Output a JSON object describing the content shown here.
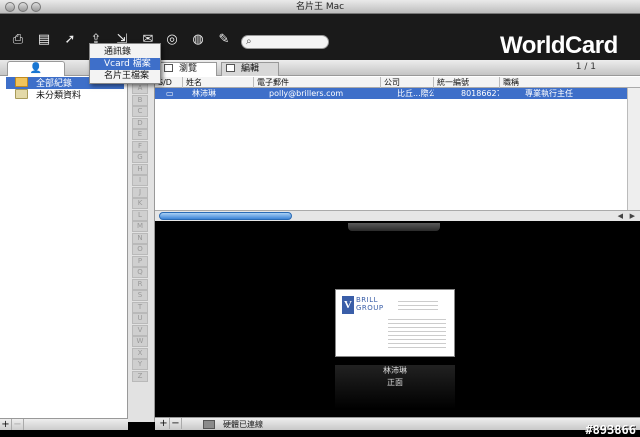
{
  "window": {
    "title": "名片王 Mac"
  },
  "toolbar": {
    "icons": [
      "scan-icon",
      "new-card-icon",
      "cursor-icon",
      "export-icon",
      "share-icon",
      "mail-icon",
      "sync-icon",
      "web-icon",
      "edit-icon"
    ],
    "brand": "WorldCard",
    "search_value": ""
  },
  "export_menu": {
    "items": [
      "通訊錄",
      "Vcard 檔案",
      "名片王檔案"
    ],
    "highlighted": "Vcard 檔案"
  },
  "sidebar": {
    "folders": [
      {
        "label": "全部紀錄",
        "selected": true
      },
      {
        "label": "未分類資料",
        "selected": false
      }
    ]
  },
  "alpha_index": [
    "A",
    "B",
    "C",
    "D",
    "E",
    "F",
    "G",
    "H",
    "I",
    "J",
    "K",
    "L",
    "M",
    "N",
    "O",
    "P",
    "Q",
    "R",
    "S",
    "T",
    "U",
    "V",
    "W",
    "X",
    "Y",
    "Z"
  ],
  "tabs": [
    {
      "label": "瀏覽",
      "active": true
    },
    {
      "label": "編輯",
      "active": false
    }
  ],
  "pager": "1 / 1",
  "table": {
    "columns": [
      "S/D",
      "姓名",
      "電子郵件",
      "公司",
      "統一編號",
      "職稱"
    ],
    "rows": [
      {
        "sd": "",
        "name": "林沛琳",
        "email": "polly@brillers.com",
        "company": "比丘...際公司",
        "tax_id": "80186627",
        "title": "專業執行主任"
      }
    ]
  },
  "preview": {
    "card_brand": "BRILL\nGROUP",
    "name_caption": "林沛琳",
    "side_caption": "正面"
  },
  "status": {
    "text": "硬體已連線"
  },
  "watermark": "#893866"
}
